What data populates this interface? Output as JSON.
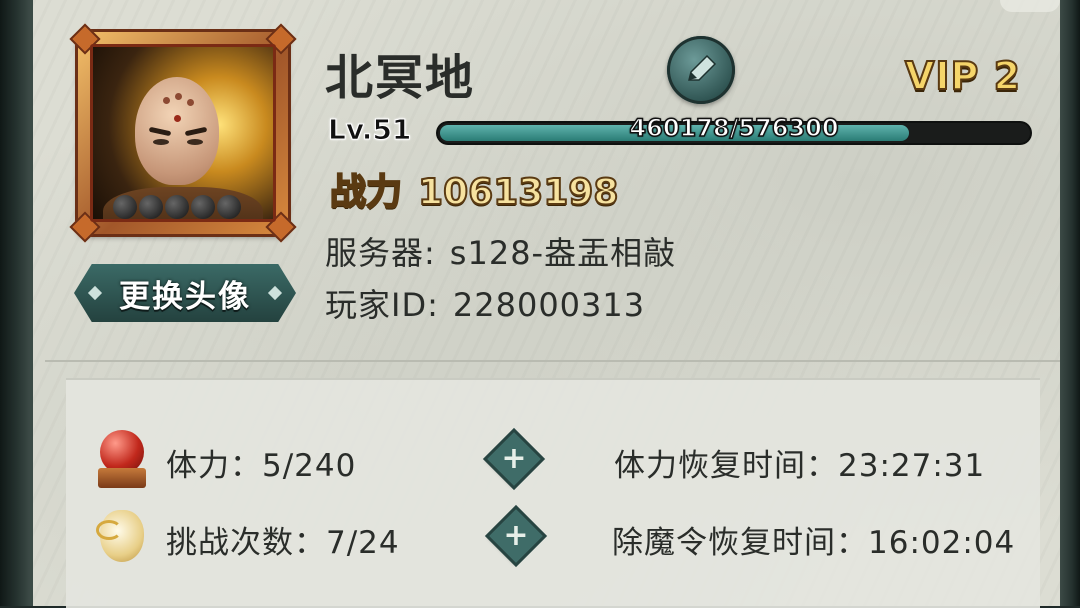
{
  "player": {
    "name": "北冥地",
    "vip": "VIP 2",
    "level": "Lv.51",
    "xp_text": "460178/576300",
    "xp_fraction": 0.798,
    "power_label": "战力",
    "power_value": "10613198",
    "server_label": "服务器:",
    "server_value": "s128-盎盂相敲",
    "id_label": "玩家ID:",
    "id_value": "228000313"
  },
  "avatar": {
    "change_button_label": "更换头像"
  },
  "stats": {
    "stamina_label": "体力：5/240",
    "stamina_recover": "体力恢复时间：23:27:31",
    "challenge_label": "挑战次数：7/24",
    "token_recover": "除魔令恢复时间：16:02:04"
  },
  "icons": {
    "edit": "pencil-icon",
    "stamina": "red-orb-icon",
    "challenge": "gourd-token-icon",
    "add": "plus-icon"
  },
  "colors": {
    "panel_bg": "#dcddd3",
    "accent_teal": "#2f5452",
    "xp_fill": "#2a7c75",
    "gold_text": "#f5d56a"
  }
}
